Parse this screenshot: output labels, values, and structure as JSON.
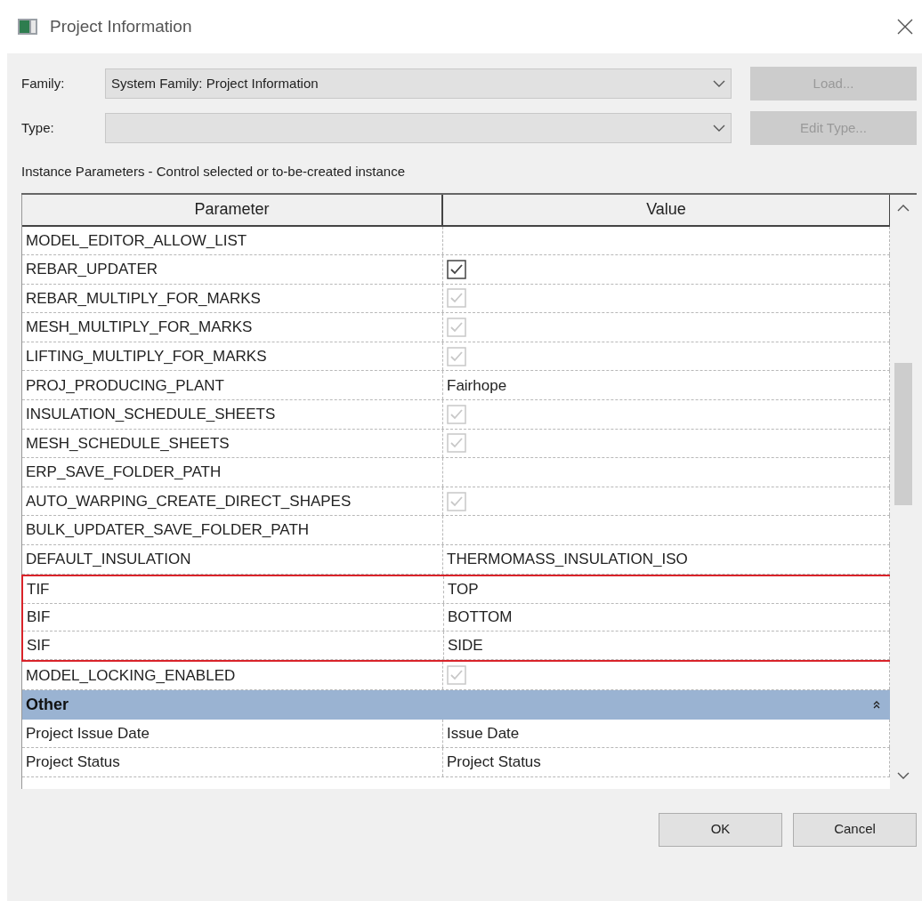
{
  "window": {
    "title": "Project Information"
  },
  "family": {
    "label": "Family:",
    "value": "System Family: Project Information"
  },
  "type": {
    "label": "Type:"
  },
  "load_button": {
    "label": "Load...",
    "disabled": true
  },
  "edit_type_button": {
    "label": "Edit Type...",
    "disabled": true
  },
  "caption": "Instance Parameters - Control selected or to-be-created instance",
  "table": {
    "columns": [
      "Parameter",
      "Value"
    ],
    "rows": [
      {
        "kind": "text",
        "parameter": "MODEL_EDITOR_ALLOW_LIST",
        "highlighted": false
      },
      {
        "kind": "checkbox",
        "parameter": "REBAR_UPDATER",
        "checked": true,
        "disabled": false,
        "highlighted": false
      },
      {
        "kind": "checkbox",
        "parameter": "REBAR_MULTIPLY_FOR_MARKS",
        "checked": true,
        "disabled": true,
        "highlighted": false
      },
      {
        "kind": "checkbox",
        "parameter": "MESH_MULTIPLY_FOR_MARKS",
        "checked": true,
        "disabled": true,
        "highlighted": false
      },
      {
        "kind": "checkbox",
        "parameter": "LIFTING_MULTIPLY_FOR_MARKS",
        "checked": true,
        "disabled": true,
        "highlighted": false
      },
      {
        "kind": "text",
        "parameter": "PROJ_PRODUCING_PLANT",
        "value": "Fairhope",
        "highlighted": false
      },
      {
        "kind": "checkbox",
        "parameter": "INSULATION_SCHEDULE_SHEETS",
        "checked": true,
        "disabled": true,
        "highlighted": false
      },
      {
        "kind": "checkbox",
        "parameter": "MESH_SCHEDULE_SHEETS",
        "checked": true,
        "disabled": true,
        "highlighted": false
      },
      {
        "kind": "text",
        "parameter": "ERP_SAVE_FOLDER_PATH",
        "highlighted": false
      },
      {
        "kind": "checkbox",
        "parameter": "AUTO_WARPING_CREATE_DIRECT_SHAPES",
        "checked": true,
        "disabled": true,
        "highlighted": false
      },
      {
        "kind": "text",
        "parameter": "BULK_UPDATER_SAVE_FOLDER_PATH",
        "highlighted": false
      },
      {
        "kind": "text",
        "parameter": "DEFAULT_INSULATION",
        "value": "THERMOMASS_INSULATION_ISO",
        "highlighted": false
      },
      {
        "kind": "text",
        "parameter": "TIF",
        "value": "TOP",
        "highlighted": true
      },
      {
        "kind": "text",
        "parameter": "BIF",
        "value": "BOTTOM",
        "highlighted": true
      },
      {
        "kind": "text",
        "parameter": "SIF",
        "value": "SIDE",
        "highlighted": true
      },
      {
        "kind": "checkbox",
        "parameter": "MODEL_LOCKING_ENABLED",
        "checked": true,
        "disabled": true,
        "highlighted": false
      },
      {
        "kind": "section",
        "parameter": "Other",
        "expanded": true
      },
      {
        "kind": "text",
        "parameter": "Project Issue Date",
        "value": "Issue Date",
        "highlighted": false
      },
      {
        "kind": "text",
        "parameter": "Project Status",
        "value": "Project Status",
        "highlighted": false
      }
    ]
  },
  "buttons": [
    "OK",
    "Cancel"
  ]
}
